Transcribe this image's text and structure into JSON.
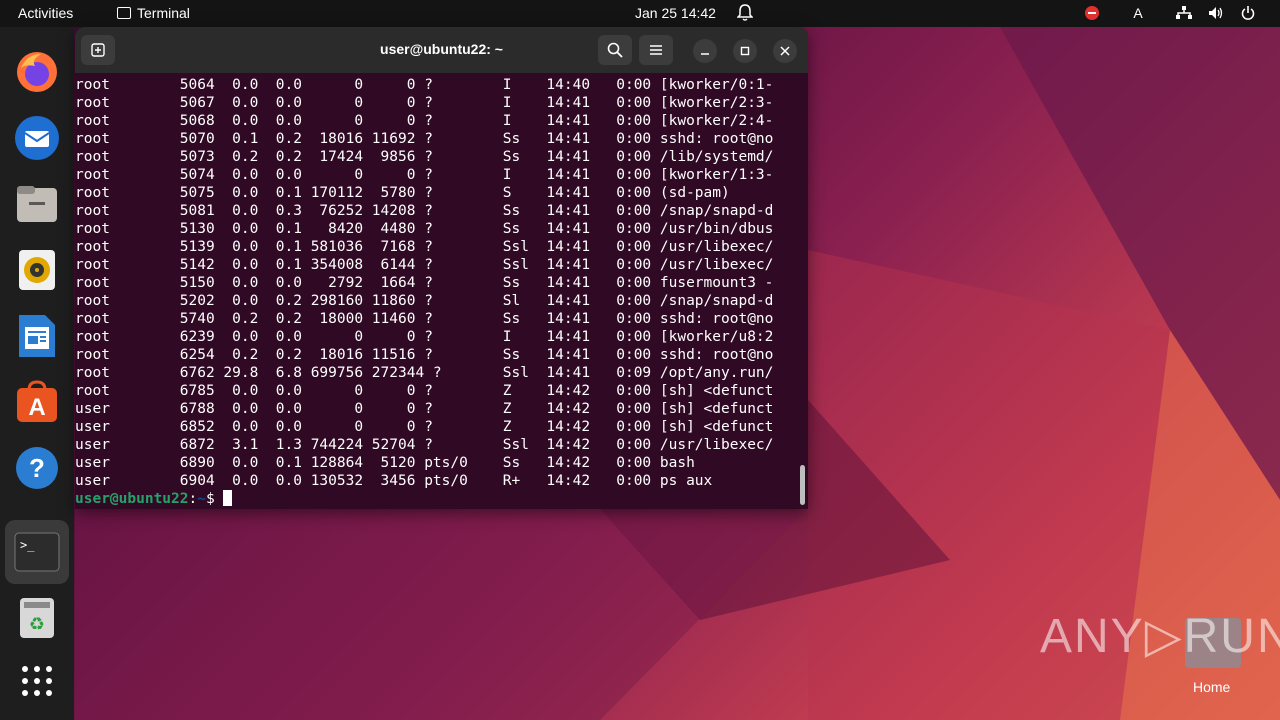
{
  "topbar": {
    "activities": "Activities",
    "app_name": "Terminal",
    "clock": "Jan 25  14:42",
    "keyboard_layout": "A"
  },
  "dock": {
    "items": [
      "firefox-icon",
      "thunderbird-icon",
      "files-icon",
      "rhythmbox-icon",
      "writer-icon",
      "app-center-icon",
      "help-icon",
      "terminal-icon",
      "trash-icon",
      "show-apps-icon"
    ]
  },
  "terminal": {
    "title": "user@ubuntu22: ~",
    "lines": [
      "root        5064  0.0  0.0      0     0 ?        I    14:40   0:00 [kworker/0:1-",
      "root        5067  0.0  0.0      0     0 ?        I    14:41   0:00 [kworker/2:3-",
      "root        5068  0.0  0.0      0     0 ?        I    14:41   0:00 [kworker/2:4-",
      "root        5070  0.1  0.2  18016 11692 ?        Ss   14:41   0:00 sshd: root@no",
      "root        5073  0.2  0.2  17424  9856 ?        Ss   14:41   0:00 /lib/systemd/",
      "root        5074  0.0  0.0      0     0 ?        I    14:41   0:00 [kworker/1:3-",
      "root        5075  0.0  0.1 170112  5780 ?        S    14:41   0:00 (sd-pam)",
      "root        5081  0.0  0.3  76252 14208 ?        Ss   14:41   0:00 /snap/snapd-d",
      "root        5130  0.0  0.1   8420  4480 ?        Ss   14:41   0:00 /usr/bin/dbus",
      "root        5139  0.0  0.1 581036  7168 ?        Ssl  14:41   0:00 /usr/libexec/",
      "root        5142  0.0  0.1 354008  6144 ?        Ssl  14:41   0:00 /usr/libexec/",
      "root        5150  0.0  0.0   2792  1664 ?        Ss   14:41   0:00 fusermount3 -",
      "root        5202  0.0  0.2 298160 11860 ?        Sl   14:41   0:00 /snap/snapd-d",
      "root        5740  0.2  0.2  18000 11460 ?        Ss   14:41   0:00 sshd: root@no",
      "root        6239  0.0  0.0      0     0 ?        I    14:41   0:00 [kworker/u8:2",
      "root        6254  0.2  0.2  18016 11516 ?        Ss   14:41   0:00 sshd: root@no",
      "root        6762 29.8  6.8 699756 272344 ?       Ssl  14:41   0:09 /opt/any.run/",
      "root        6785  0.0  0.0      0     0 ?        Z    14:42   0:00 [sh] <defunct",
      "user        6788  0.0  0.0      0     0 ?        Z    14:42   0:00 [sh] <defunct",
      "user        6852  0.0  0.0      0     0 ?        Z    14:42   0:00 [sh] <defunct",
      "user        6872  3.1  1.3 744224 52704 ?        Ssl  14:42   0:00 /usr/libexec/",
      "user        6890  0.0  0.1 128864  5120 pts/0    Ss   14:42   0:00 bash",
      "user        6904  0.0  0.0 130532  3456 pts/0    R+   14:42   0:00 ps aux"
    ],
    "prompt_user": "user@ubuntu22",
    "prompt_sep": ":",
    "prompt_path": "~",
    "prompt_symbol": "$ "
  },
  "desktop": {
    "watermark": "ANY▷RUN",
    "home_label": "Home"
  }
}
